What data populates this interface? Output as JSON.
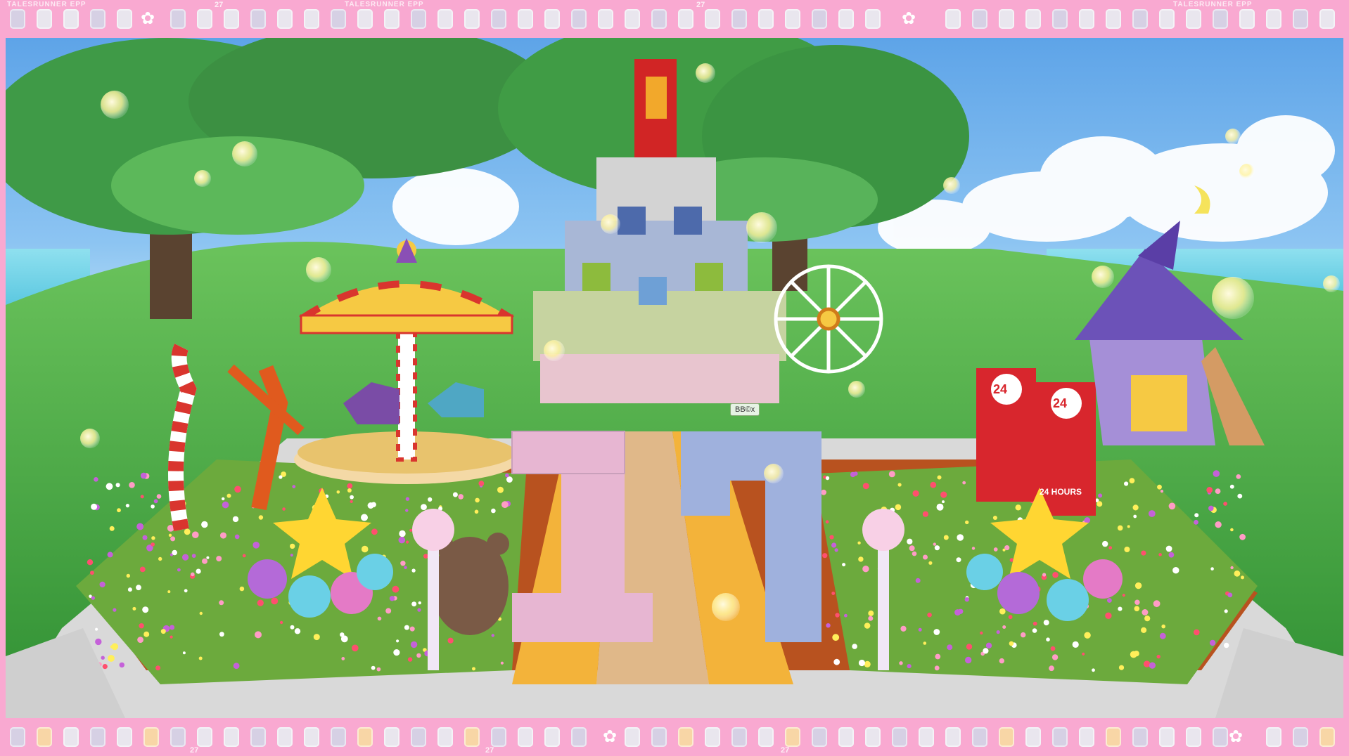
{
  "film_strip": {
    "top_left_text": "TALESRUNNER EPP",
    "top_mid_text": "TALESRUNNER EPP",
    "top_right_text": "TALESRUNNER EPP",
    "frame_number_1": "27",
    "frame_number_2": "27",
    "frame_number_3": "27",
    "frame_number_4": "27",
    "frame_number_5": "27"
  },
  "scene": {
    "big_number_1": "1",
    "big_number_2": "7",
    "player_tag": "BB©x",
    "vending_label": "24",
    "vending_sub": "24 HOURS"
  },
  "colors": {
    "frame_pink": "#f9a9d1",
    "sky": "#7fb9ef",
    "grass": "#4aa84a",
    "digit_1": "#e7b6d2",
    "digit_7": "#9fb1dd"
  }
}
